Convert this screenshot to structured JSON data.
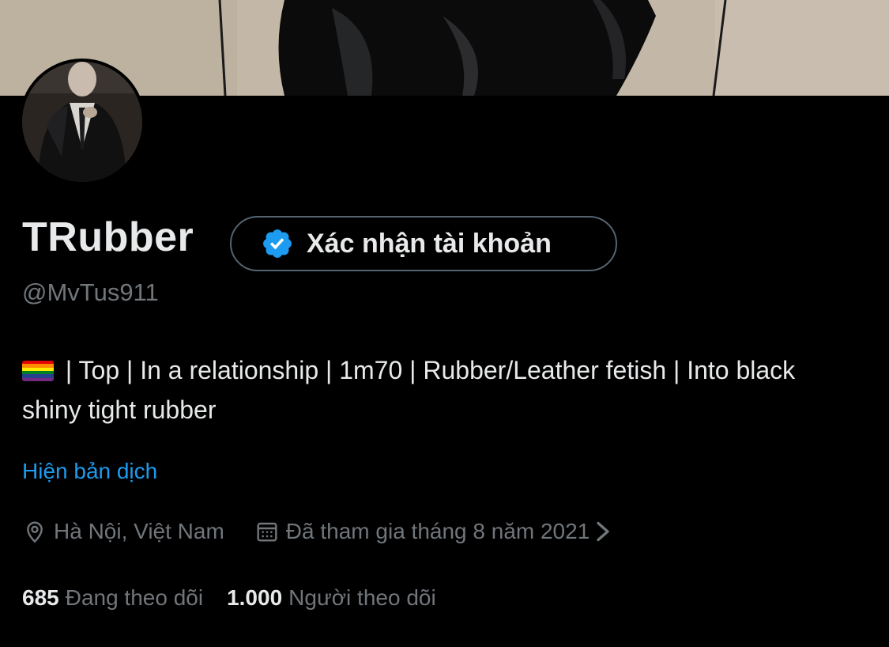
{
  "profile": {
    "display_name": "TRubber",
    "verify_button_label": "Xác nhận tài khoản",
    "handle": "@MvTus911",
    "bio": " | Top | In a relationship | 1m70 | Rubber/Leather fetish | Into black shiny tight rubber",
    "bio_flag_icon": "rainbow-flag-emoji",
    "translate_link": "Hiện bản dịch",
    "location": "Hà Nội, Việt Nam",
    "joined": "Đã tham gia tháng 8 năm 2021",
    "following_count": "685",
    "following_label": "Đang theo dõi",
    "followers_count": "1.000",
    "followers_label": "Người theo dõi"
  },
  "colors": {
    "background": "#000000",
    "primary_text": "#e7e9ea",
    "secondary_text": "#71767b",
    "link_blue": "#1d9bf0",
    "verified_badge": "#1d9bf0",
    "button_border": "#536471"
  }
}
